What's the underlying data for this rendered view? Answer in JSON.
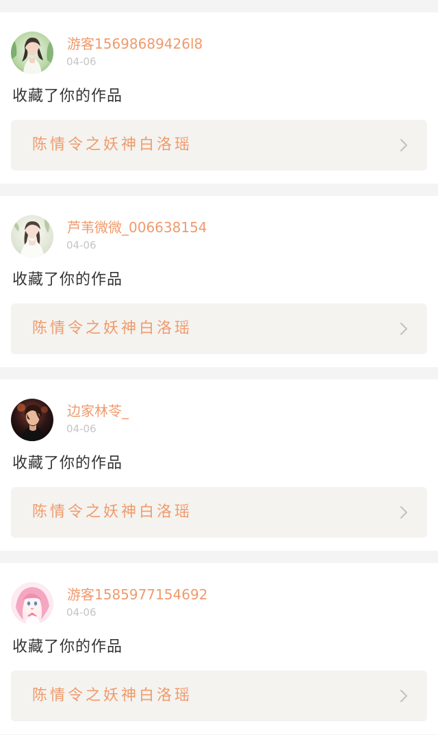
{
  "colors": {
    "page_background": "#f5f4f4",
    "card_background": "#ffffff",
    "username": "#ef9a6c",
    "date": "#c4c4c4",
    "action_text": "#333333",
    "work_panel": "#f4f3ef",
    "work_title": "#ef9a6c",
    "chevron": "#c2c2c2"
  },
  "notifications": [
    {
      "avatar": "avatar-woman-green-garden",
      "username": "游客15698689426l8",
      "date": "04-06",
      "action": "收藏了你的作品",
      "work_title": "陈情令之妖神白洛瑶"
    },
    {
      "avatar": "avatar-woman-white-dress",
      "username": "芦苇微微_006638154",
      "date": "04-06",
      "action": "收藏了你的作品",
      "work_title": "陈情令之妖神白洛瑶"
    },
    {
      "avatar": "avatar-man-dark-portrait",
      "username": "边家林苓_",
      "date": "04-06",
      "action": "收藏了你的作品",
      "work_title": "陈情令之妖神白洛瑶"
    },
    {
      "avatar": "avatar-anime-pink-hair",
      "username": "游客1585977154692",
      "date": "04-06",
      "action": "收藏了你的作品",
      "work_title": "陈情令之妖神白洛瑶"
    }
  ]
}
